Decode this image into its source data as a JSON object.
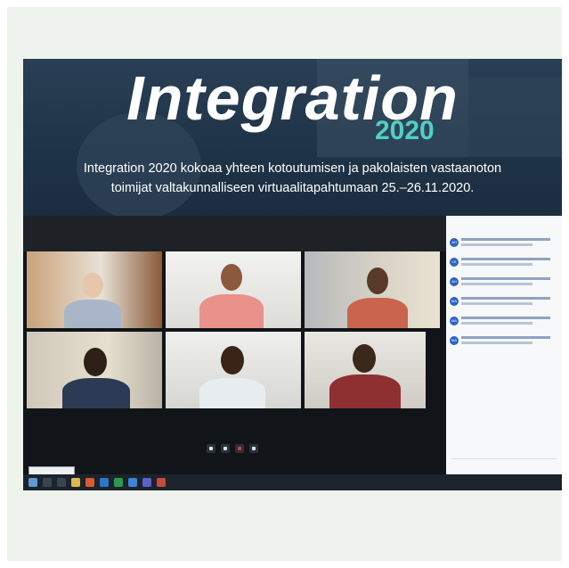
{
  "banner": {
    "title": "Integration",
    "year": "2020",
    "caption_line1": "Integration 2020 kokoaa yhteen kotoutumisen ja pakolaisten vastaanoton",
    "caption_line2": "toimijat valtakunnalliseen virtuaalitapahtumaan 25.–26.11.2020."
  },
  "colors": {
    "banner_bg": "#1f3347",
    "year_accent": "#4fd1c5",
    "chat_avatar": "#2f63c6",
    "taskbar": "#1c232c"
  },
  "meeting": {
    "participants": [
      {
        "initials": ""
      },
      {
        "initials": ""
      },
      {
        "initials": ""
      },
      {
        "initials": ""
      },
      {
        "initials": ""
      },
      {
        "initials": ""
      }
    ],
    "controls": [
      "camera-icon",
      "microphone-icon",
      "screen-share-icon",
      "settings-icon"
    ]
  },
  "chat": {
    "avatars": [
      "AH",
      "LE",
      "AH",
      "MA",
      "MA",
      "MA"
    ]
  }
}
